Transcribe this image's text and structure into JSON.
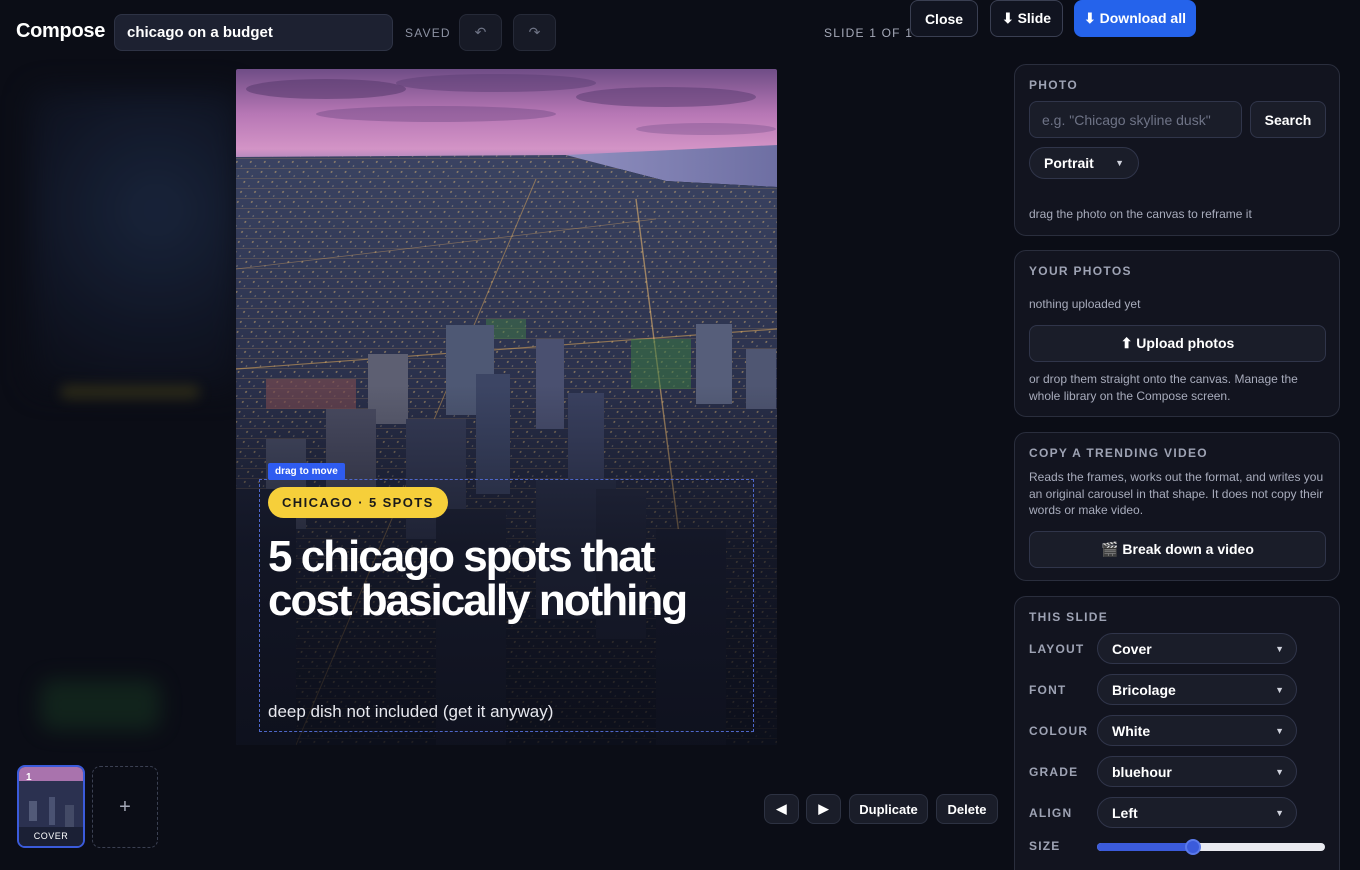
{
  "app": {
    "title": "Compose"
  },
  "project": {
    "name": "chicago on a budget",
    "status": "SAVED"
  },
  "toolbar": {
    "undo_icon": "undo-icon",
    "redo_icon": "redo-icon",
    "slide_counter": "SLIDE 1 OF 1",
    "close_label": "Close",
    "download_slide_label": "⬇ Slide",
    "download_all_label": "⬇ Download all",
    "accent": "#2563eb"
  },
  "canvas": {
    "drag_hint": "drag to move",
    "badge": "CHICAGO · 5 SPOTS",
    "headline": "5 chicago spots that cost basically nothing",
    "subline": "deep dish not included (get it anyway)",
    "badge_color": "#f6cf3a"
  },
  "filmstrip": {
    "slides": [
      {
        "number": "1",
        "label": "COVER"
      }
    ],
    "add_label": "+"
  },
  "slide_controls": {
    "prev_label": "◀",
    "next_label": "▶",
    "duplicate_label": "Duplicate",
    "delete_label": "Delete"
  },
  "panel": {
    "photo": {
      "heading": "PHOTO",
      "search_placeholder": "e.g. \"Chicago skyline dusk\"",
      "search_label": "Search",
      "orientation": "Portrait",
      "hint": "drag the photo on the canvas to reframe it"
    },
    "your_photos": {
      "heading": "YOUR PHOTOS",
      "empty_text": "nothing uploaded yet",
      "upload_label": "⬆ Upload photos",
      "hint": "or drop them straight onto the canvas. Manage the whole library on the Compose screen."
    },
    "trending": {
      "heading": "COPY A TRENDING VIDEO",
      "description": "Reads the frames, works out the format, and writes you an original carousel in that shape. It does not copy their words or make video.",
      "button_label": "🎬 Break down a video"
    },
    "this_slide": {
      "heading": "THIS SLIDE",
      "layout_label": "LAYOUT",
      "layout_value": "Cover",
      "font_label": "FONT",
      "font_value": "Bricolage",
      "colour_label": "COLOUR",
      "colour_value": "White",
      "grade_label": "GRADE",
      "grade_value": "bluehour",
      "align_label": "ALIGN",
      "align_value": "Left",
      "size_label": "SIZE",
      "size_fraction": 0.42
    }
  }
}
